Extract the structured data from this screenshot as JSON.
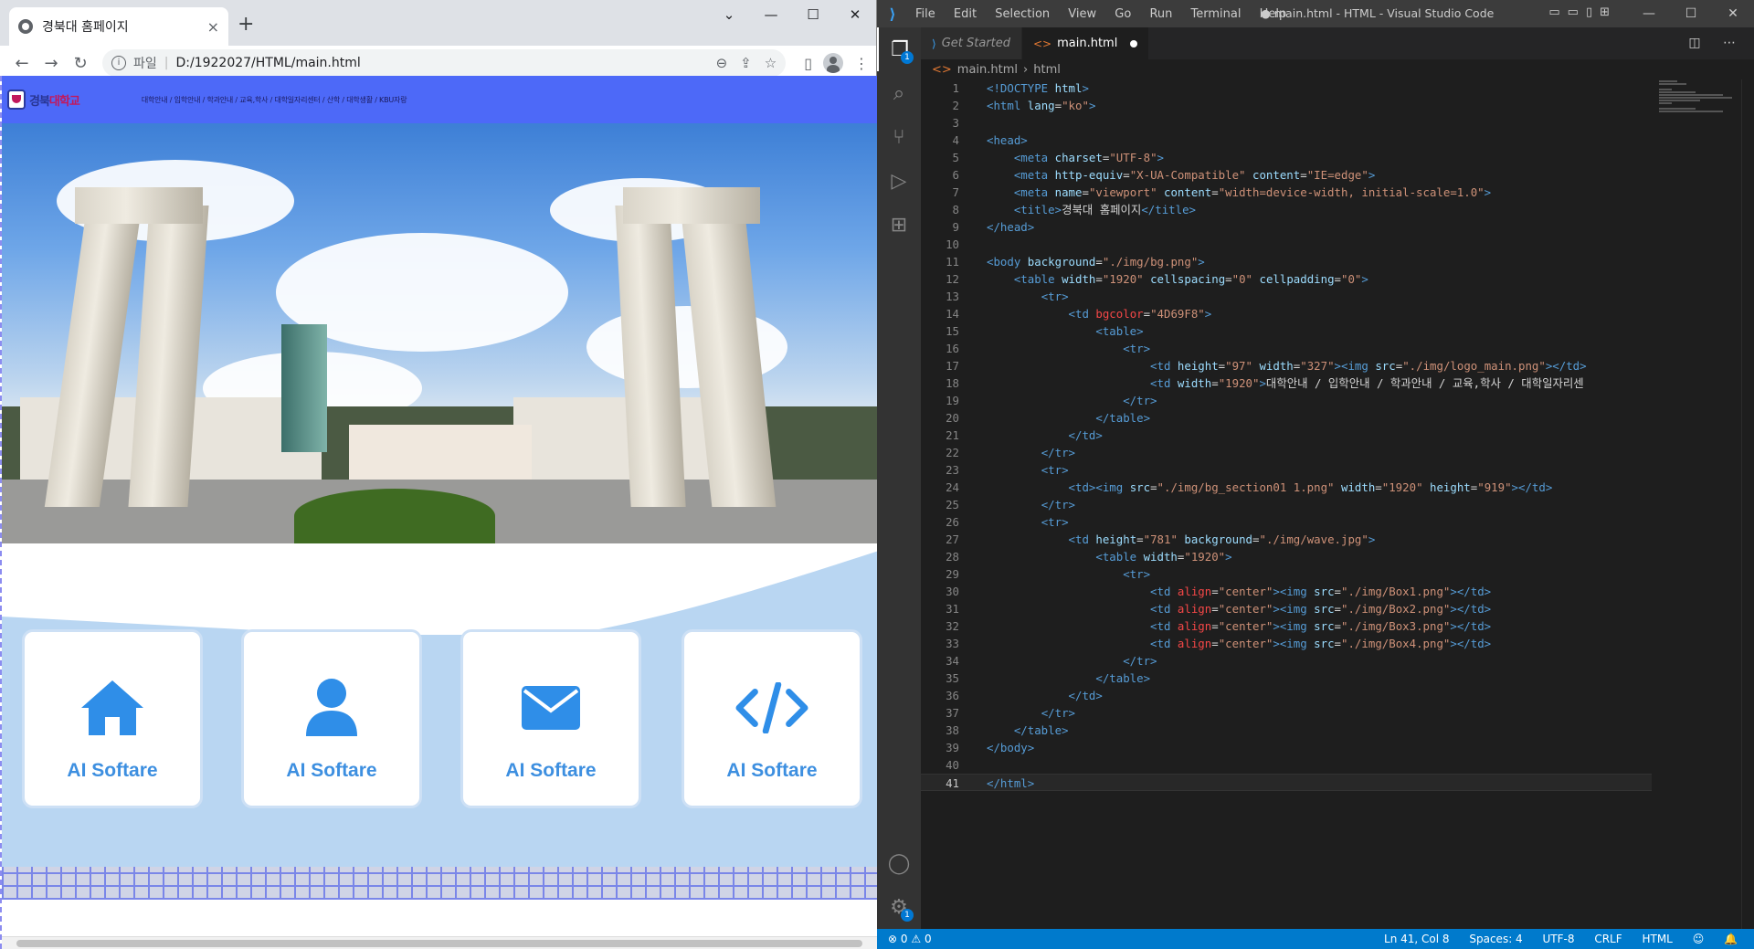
{
  "browser": {
    "tab_title": "경북대 홈페이지",
    "tab_close": "×",
    "new_tab": "+",
    "scheme": "파일",
    "url": "D:/1922027/HTML/main.html",
    "window_controls": [
      "⌄",
      "—",
      "☐",
      "✕"
    ]
  },
  "site": {
    "logo_text_a": "경북",
    "logo_text_b": "대학교",
    "gnb": "대학안내 / 입학안내 / 학과안내 / 교육,학사 / 대학일자리센터 / 산학 / 대학생활 / KBU자랑",
    "boxes": [
      {
        "icon": "home-icon",
        "label": "AI Softare"
      },
      {
        "icon": "user-icon",
        "label": "AI Softare"
      },
      {
        "icon": "envelope-icon",
        "label": "AI Softare"
      },
      {
        "icon": "code-icon",
        "label": "AI Softare"
      }
    ],
    "accent": "#4D69F8",
    "box_label_color": "#3d8fe0"
  },
  "vscode": {
    "menu": [
      "File",
      "Edit",
      "Selection",
      "View",
      "Go",
      "Run",
      "Terminal",
      "Help"
    ],
    "window_title": "● main.html - HTML - Visual Studio Code",
    "tabs": [
      {
        "label": "Get Started",
        "icon": "vscode-icon",
        "active": false
      },
      {
        "label": "main.html",
        "icon": "html-icon",
        "active": true,
        "modified": true
      }
    ],
    "breadcrumb": [
      "main.html",
      "html"
    ],
    "current_line": 41,
    "activity_badges": {
      "explorer": "1",
      "settings": "1"
    },
    "status": {
      "errors": "0",
      "warnings": "0",
      "position": "Ln 41, Col 8",
      "spaces": "Spaces: 4",
      "encoding": "UTF-8",
      "eol": "CRLF",
      "language": "HTML"
    },
    "code_lines": [
      [
        [
          "t",
          "<!DOCTYPE"
        ],
        [
          "tx",
          " "
        ],
        [
          "a",
          "html"
        ],
        [
          "t",
          ">"
        ]
      ],
      [
        [
          "t",
          "<html"
        ],
        [
          "tx",
          " "
        ],
        [
          "a",
          "lang"
        ],
        [
          "tx",
          "="
        ],
        [
          "s",
          "\"ko\""
        ],
        [
          "t",
          ">"
        ]
      ],
      [],
      [
        [
          "t",
          "<head>"
        ]
      ],
      [
        [
          "tx",
          "    "
        ],
        [
          "t",
          "<meta"
        ],
        [
          "tx",
          " "
        ],
        [
          "a",
          "charset"
        ],
        [
          "tx",
          "="
        ],
        [
          "s",
          "\"UTF-8\""
        ],
        [
          "t",
          ">"
        ]
      ],
      [
        [
          "tx",
          "    "
        ],
        [
          "t",
          "<meta"
        ],
        [
          "tx",
          " "
        ],
        [
          "a",
          "http-equiv"
        ],
        [
          "tx",
          "="
        ],
        [
          "s",
          "\"X-UA-Compatible\""
        ],
        [
          "tx",
          " "
        ],
        [
          "a",
          "content"
        ],
        [
          "tx",
          "="
        ],
        [
          "s",
          "\"IE=edge\""
        ],
        [
          "t",
          ">"
        ]
      ],
      [
        [
          "tx",
          "    "
        ],
        [
          "t",
          "<meta"
        ],
        [
          "tx",
          " "
        ],
        [
          "a",
          "name"
        ],
        [
          "tx",
          "="
        ],
        [
          "s",
          "\"viewport\""
        ],
        [
          "tx",
          " "
        ],
        [
          "a",
          "content"
        ],
        [
          "tx",
          "="
        ],
        [
          "s",
          "\"width=device-width, initial-scale=1.0\""
        ],
        [
          "t",
          ">"
        ]
      ],
      [
        [
          "tx",
          "    "
        ],
        [
          "t",
          "<title>"
        ],
        [
          "tx",
          "경북대 홈페이지"
        ],
        [
          "t",
          "</title>"
        ]
      ],
      [
        [
          "t",
          "</head>"
        ]
      ],
      [],
      [
        [
          "t",
          "<body"
        ],
        [
          "tx",
          " "
        ],
        [
          "a",
          "background"
        ],
        [
          "tx",
          "="
        ],
        [
          "s",
          "\"./img/bg.png\""
        ],
        [
          "t",
          ">"
        ]
      ],
      [
        [
          "tx",
          "    "
        ],
        [
          "t",
          "<table"
        ],
        [
          "tx",
          " "
        ],
        [
          "a",
          "width"
        ],
        [
          "tx",
          "="
        ],
        [
          "s",
          "\"1920\""
        ],
        [
          "tx",
          " "
        ],
        [
          "a",
          "cellspacing"
        ],
        [
          "tx",
          "="
        ],
        [
          "s",
          "\"0\""
        ],
        [
          "tx",
          " "
        ],
        [
          "a",
          "cellpadding"
        ],
        [
          "tx",
          "="
        ],
        [
          "s",
          "\"0\""
        ],
        [
          "t",
          ">"
        ]
      ],
      [
        [
          "tx",
          "        "
        ],
        [
          "t",
          "<tr>"
        ]
      ],
      [
        [
          "tx",
          "            "
        ],
        [
          "t",
          "<td"
        ],
        [
          "tx",
          " "
        ],
        [
          "at",
          "bgcolor"
        ],
        [
          "tx",
          "="
        ],
        [
          "s",
          "\"4D69F8\""
        ],
        [
          "t",
          ">"
        ]
      ],
      [
        [
          "tx",
          "                "
        ],
        [
          "t",
          "<table>"
        ]
      ],
      [
        [
          "tx",
          "                    "
        ],
        [
          "t",
          "<tr>"
        ]
      ],
      [
        [
          "tx",
          "                        "
        ],
        [
          "t",
          "<td"
        ],
        [
          "tx",
          " "
        ],
        [
          "a",
          "height"
        ],
        [
          "tx",
          "="
        ],
        [
          "s",
          "\"97\""
        ],
        [
          "tx",
          " "
        ],
        [
          "a",
          "width"
        ],
        [
          "tx",
          "="
        ],
        [
          "s",
          "\"327\""
        ],
        [
          "t",
          ">"
        ],
        [
          "t",
          "<img"
        ],
        [
          "tx",
          " "
        ],
        [
          "a",
          "src"
        ],
        [
          "tx",
          "="
        ],
        [
          "s",
          "\"./img/logo_main.png\""
        ],
        [
          "t",
          "></td>"
        ]
      ],
      [
        [
          "tx",
          "                        "
        ],
        [
          "t",
          "<td"
        ],
        [
          "tx",
          " "
        ],
        [
          "a",
          "width"
        ],
        [
          "tx",
          "="
        ],
        [
          "s",
          "\"1920\""
        ],
        [
          "t",
          ">"
        ],
        [
          "tx",
          "대학안내 / 입학안내 / 학과안내 / 교육,학사 / 대학일자리센"
        ]
      ],
      [
        [
          "tx",
          "                    "
        ],
        [
          "t",
          "</tr>"
        ]
      ],
      [
        [
          "tx",
          "                "
        ],
        [
          "t",
          "</table>"
        ]
      ],
      [
        [
          "tx",
          "            "
        ],
        [
          "t",
          "</td>"
        ]
      ],
      [
        [
          "tx",
          "        "
        ],
        [
          "t",
          "</tr>"
        ]
      ],
      [
        [
          "tx",
          "        "
        ],
        [
          "t",
          "<tr>"
        ]
      ],
      [
        [
          "tx",
          "            "
        ],
        [
          "t",
          "<td><img"
        ],
        [
          "tx",
          " "
        ],
        [
          "a",
          "src"
        ],
        [
          "tx",
          "="
        ],
        [
          "s",
          "\"./img/bg_section01 1.png\""
        ],
        [
          "tx",
          " "
        ],
        [
          "a",
          "width"
        ],
        [
          "tx",
          "="
        ],
        [
          "s",
          "\"1920\""
        ],
        [
          "tx",
          " "
        ],
        [
          "a",
          "height"
        ],
        [
          "tx",
          "="
        ],
        [
          "s",
          "\"919\""
        ],
        [
          "t",
          "></td>"
        ]
      ],
      [
        [
          "tx",
          "        "
        ],
        [
          "t",
          "</tr>"
        ]
      ],
      [
        [
          "tx",
          "        "
        ],
        [
          "t",
          "<tr>"
        ]
      ],
      [
        [
          "tx",
          "            "
        ],
        [
          "t",
          "<td"
        ],
        [
          "tx",
          " "
        ],
        [
          "a",
          "height"
        ],
        [
          "tx",
          "="
        ],
        [
          "s",
          "\"781\""
        ],
        [
          "tx",
          " "
        ],
        [
          "a",
          "background"
        ],
        [
          "tx",
          "="
        ],
        [
          "s",
          "\"./img/wave.jpg\""
        ],
        [
          "t",
          ">"
        ]
      ],
      [
        [
          "tx",
          "                "
        ],
        [
          "t",
          "<table"
        ],
        [
          "tx",
          " "
        ],
        [
          "a",
          "width"
        ],
        [
          "tx",
          "="
        ],
        [
          "s",
          "\"1920\""
        ],
        [
          "t",
          ">"
        ]
      ],
      [
        [
          "tx",
          "                    "
        ],
        [
          "t",
          "<tr>"
        ]
      ],
      [
        [
          "tx",
          "                        "
        ],
        [
          "t",
          "<td"
        ],
        [
          "tx",
          " "
        ],
        [
          "at",
          "align"
        ],
        [
          "tx",
          "="
        ],
        [
          "s",
          "\"center\""
        ],
        [
          "t",
          ">"
        ],
        [
          "t",
          "<img"
        ],
        [
          "tx",
          " "
        ],
        [
          "a",
          "src"
        ],
        [
          "tx",
          "="
        ],
        [
          "s",
          "\"./img/Box1.png\""
        ],
        [
          "t",
          "></td>"
        ]
      ],
      [
        [
          "tx",
          "                        "
        ],
        [
          "t",
          "<td"
        ],
        [
          "tx",
          " "
        ],
        [
          "at",
          "align"
        ],
        [
          "tx",
          "="
        ],
        [
          "s",
          "\"center\""
        ],
        [
          "t",
          ">"
        ],
        [
          "t",
          "<img"
        ],
        [
          "tx",
          " "
        ],
        [
          "a",
          "src"
        ],
        [
          "tx",
          "="
        ],
        [
          "s",
          "\"./img/Box2.png\""
        ],
        [
          "t",
          "></td>"
        ]
      ],
      [
        [
          "tx",
          "                        "
        ],
        [
          "t",
          "<td"
        ],
        [
          "tx",
          " "
        ],
        [
          "at",
          "align"
        ],
        [
          "tx",
          "="
        ],
        [
          "s",
          "\"center\""
        ],
        [
          "t",
          ">"
        ],
        [
          "t",
          "<img"
        ],
        [
          "tx",
          " "
        ],
        [
          "a",
          "src"
        ],
        [
          "tx",
          "="
        ],
        [
          "s",
          "\"./img/Box3.png\""
        ],
        [
          "t",
          "></td>"
        ]
      ],
      [
        [
          "tx",
          "                        "
        ],
        [
          "t",
          "<td"
        ],
        [
          "tx",
          " "
        ],
        [
          "at",
          "align"
        ],
        [
          "tx",
          "="
        ],
        [
          "s",
          "\"center\""
        ],
        [
          "t",
          ">"
        ],
        [
          "t",
          "<img"
        ],
        [
          "tx",
          " "
        ],
        [
          "a",
          "src"
        ],
        [
          "tx",
          "="
        ],
        [
          "s",
          "\"./img/Box4.png\""
        ],
        [
          "t",
          "></td>"
        ]
      ],
      [
        [
          "tx",
          "                    "
        ],
        [
          "t",
          "</tr>"
        ]
      ],
      [
        [
          "tx",
          "                "
        ],
        [
          "t",
          "</table>"
        ]
      ],
      [
        [
          "tx",
          "            "
        ],
        [
          "t",
          "</td>"
        ]
      ],
      [
        [
          "tx",
          "        "
        ],
        [
          "t",
          "</tr>"
        ]
      ],
      [
        [
          "tx",
          "    "
        ],
        [
          "t",
          "</table>"
        ]
      ],
      [
        [
          "t",
          "</body>"
        ]
      ],
      [],
      [
        [
          "t",
          "</html>"
        ]
      ]
    ]
  }
}
